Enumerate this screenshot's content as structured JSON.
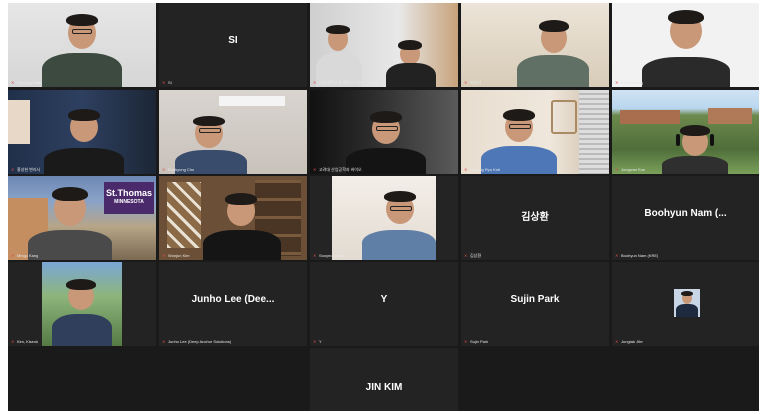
{
  "app": "Video meeting gallery view",
  "tiles": [
    {
      "name": "Seonggu Bae",
      "caption": "Seonggu Bae"
    },
    {
      "name": "SI",
      "caption": "SI"
    },
    {
      "name": "서울대 정보통계학과 이상은 서울대",
      "caption": "서울대학교 통계학과 이성은 서울대"
    },
    {
      "name": "최원지",
      "caption": "최원지"
    },
    {
      "name": "Lee Kihoang",
      "caption": "Lee Kihoang"
    },
    {
      "name": "홍성헌 변리사",
      "caption": "홍성헌 변리사"
    },
    {
      "name": "Eunkyung Cho",
      "caption": "Eunkyung Cho"
    },
    {
      "name": "고려대 산업공학과 바이오",
      "caption": "고려대 산업공학과 바이오"
    },
    {
      "name": "Hyeong Ryu Koh",
      "caption": "Hyeong Ryu Koh"
    },
    {
      "name": "Jongwan Eun",
      "caption": "Jongwan Eun"
    },
    {
      "name": "Mingu Kang",
      "caption": "Mingu Kang",
      "sign_line1": "St.Thomas",
      "sign_line2": "MINNESOTA"
    },
    {
      "name": "Wonjun Kim",
      "caption": "Wonjun Kim"
    },
    {
      "name": "Sooyeon Nam",
      "caption": "Sooyeon Nam"
    },
    {
      "name": "김상환",
      "caption": "김상환"
    },
    {
      "name": "Boohyun Nam (...",
      "caption": "Boohyun Nam (KRE)"
    },
    {
      "name": "Kim, Kiseok",
      "caption": "Kim, Kiseok"
    },
    {
      "name": "Junho Lee (Dee...",
      "caption": "Junho Lee (Deep Anchor Solutions)"
    },
    {
      "name": "Y",
      "caption": "Y"
    },
    {
      "name": "Sujin Park",
      "caption": "Sujin Park"
    },
    {
      "name": "Jungtak Jihn",
      "caption": "Jungtak Jihn"
    },
    {
      "name": "JIN KIM",
      "caption": ""
    }
  ],
  "colors": {
    "grid_bg": "#1a1a1a",
    "tile_bg": "#232323",
    "active_speaker_border": "#c8d43a",
    "mic_muted": "#e04a4a"
  }
}
